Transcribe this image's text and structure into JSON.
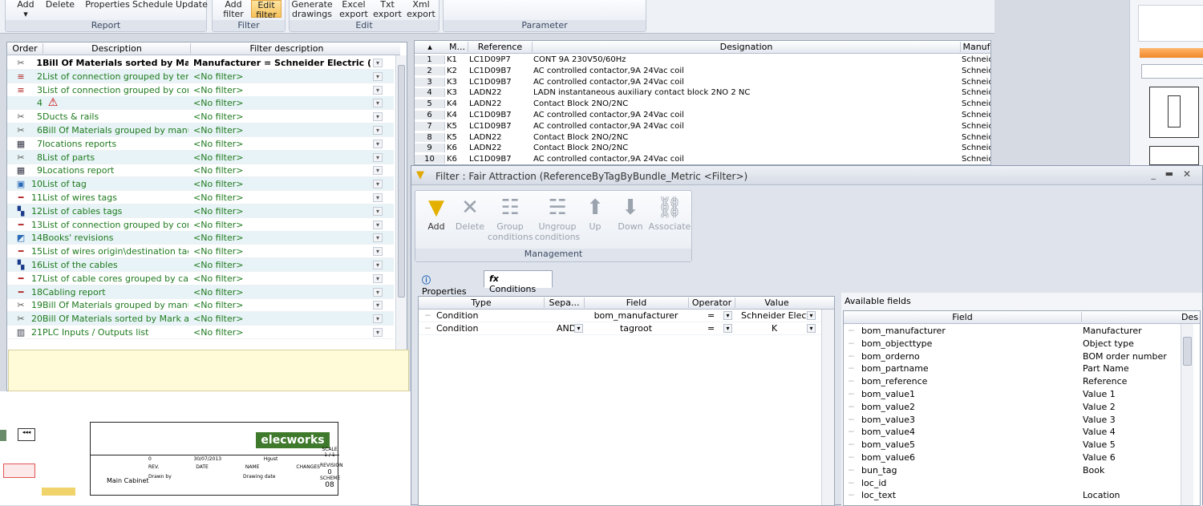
{
  "ribbon": {
    "report_buttons": [
      "Add",
      "Delete",
      "Properties",
      "Schedule",
      "Update"
    ],
    "report_group": "Report",
    "filter_buttons": [
      {
        "l1": "Add",
        "l2": "filter"
      },
      {
        "l1": "Edit",
        "l2": "filter"
      }
    ],
    "filter_group": "Filter",
    "edit_buttons": [
      {
        "l1": "Generate",
        "l2": "drawings"
      },
      {
        "l1": "Excel",
        "l2": "export"
      },
      {
        "l1": "Txt",
        "l2": "export"
      },
      {
        "l1": "Xml",
        "l2": "export"
      }
    ],
    "edit_group": "Edit",
    "parameter_group": "Parameter"
  },
  "reports": {
    "headers": {
      "order": "Order",
      "description": "Description",
      "filter": "Filter description"
    },
    "rows": [
      {
        "icon": "tools-icon",
        "order": "1",
        "description": "Bill Of Materials sorted by Mar...",
        "filter": "Manufacturer = Schneider Electric (Filt..."
      },
      {
        "icon": "list-icon",
        "order": "2",
        "description": "List of connection grouped by term...",
        "filter": "<No filter>"
      },
      {
        "icon": "list-icon",
        "order": "3",
        "description": "List of connection grouped by com...",
        "filter": "<No filter>"
      },
      {
        "icon": "warning-icon",
        "order": "4",
        "description": "",
        "filter": "<No filter>"
      },
      {
        "icon": "tools-icon",
        "order": "5",
        "description": "Ducts & rails",
        "filter": "<No filter>"
      },
      {
        "icon": "tools-icon",
        "order": "6",
        "description": "Bill Of Materials grouped by manuf...",
        "filter": "<No filter>"
      },
      {
        "icon": "cabinet-icon",
        "order": "7",
        "description": "locations reports",
        "filter": "<No filter>"
      },
      {
        "icon": "tools-icon",
        "order": "8",
        "description": "List of parts",
        "filter": "<No filter>"
      },
      {
        "icon": "cabinet-icon",
        "order": "9",
        "description": "Locations report",
        "filter": "<No filter>"
      },
      {
        "icon": "tag-icon",
        "order": "10",
        "description": "List of tag",
        "filter": "<No filter>"
      },
      {
        "icon": "wire-icon",
        "order": "11",
        "description": "List of wires tags",
        "filter": "<No filter>"
      },
      {
        "icon": "cable-icon",
        "order": "12",
        "description": "List of cables tags",
        "filter": "<No filter>"
      },
      {
        "icon": "wire-icon",
        "order": "13",
        "description": "List of connection grouped by com...",
        "filter": "<No filter>"
      },
      {
        "icon": "book-icon",
        "order": "14",
        "description": "Books' revisions",
        "filter": "<No filter>"
      },
      {
        "icon": "wire-icon",
        "order": "15",
        "description": "List of wires origin\\destination tags",
        "filter": "<No filter>"
      },
      {
        "icon": "cable-icon",
        "order": "16",
        "description": "List of the cables",
        "filter": "<No filter>"
      },
      {
        "icon": "wire-icon",
        "order": "17",
        "description": "List of cable cores grouped by cable",
        "filter": "<No filter>"
      },
      {
        "icon": "wire-icon",
        "order": "18",
        "description": "Cabling report",
        "filter": "<No filter>"
      },
      {
        "icon": "tools-icon",
        "order": "19",
        "description": "Bill Of Materials grouped by manuf...",
        "filter": "<No filter>"
      },
      {
        "icon": "tools-icon",
        "order": "20",
        "description": "Bill Of Materials sorted by Mark an...",
        "filter": "<No filter>"
      },
      {
        "icon": "plc-icon",
        "order": "21",
        "description": "PLC Inputs / Outputs list",
        "filter": "<No filter>"
      }
    ]
  },
  "components": {
    "headers": {
      "m": "M...",
      "reference": "Reference",
      "designation": "Designation",
      "manuf": "Manuf"
    },
    "rows": [
      {
        "n": "1",
        "m": "K1",
        "ref": "LC1D09P7",
        "des": "CONT 9A 230V50/60Hz",
        "man": "Schneic"
      },
      {
        "n": "2",
        "m": "K2",
        "ref": "LC1D09B7",
        "des": "AC controlled contactor,9A 24Vac coil",
        "man": "Schneic"
      },
      {
        "n": "3",
        "m": "K3",
        "ref": "LC1D09B7",
        "des": "AC controlled contactor,9A 24Vac coil",
        "man": "Schneic"
      },
      {
        "n": "4",
        "m": "K3",
        "ref": "LADN22",
        "des": "LADN instantaneous auxiliary contact block 2NO 2 NC",
        "man": "Schneic"
      },
      {
        "n": "5",
        "m": "K4",
        "ref": "LADN22",
        "des": "Contact Block 2NO/2NC",
        "man": "Schneic"
      },
      {
        "n": "6",
        "m": "K4",
        "ref": "LC1D09B7",
        "des": "AC controlled contactor,9A 24Vac coil",
        "man": "Schneic"
      },
      {
        "n": "7",
        "m": "K5",
        "ref": "LC1D09B7",
        "des": "AC controlled contactor,9A 24Vac coil",
        "man": "Schneic"
      },
      {
        "n": "8",
        "m": "K5",
        "ref": "LADN22",
        "des": "Contact Block 2NO/2NC",
        "man": "Schneic"
      },
      {
        "n": "9",
        "m": "K6",
        "ref": "LADN22",
        "des": "Contact Block 2NO/2NC",
        "man": "Schneic"
      },
      {
        "n": "10",
        "m": "K6",
        "ref": "LC1D09B7",
        "des": "AC controlled contactor,9A 24Vac coil",
        "man": "Schneic"
      }
    ]
  },
  "dialog": {
    "title": "Filter : Fair Attraction (ReferenceByTagByBundle_Metric <Filter>)",
    "management": {
      "buttons": [
        {
          "l1": "Add",
          "l2": ""
        },
        {
          "l1": "Delete",
          "l2": ""
        },
        {
          "l1": "Group",
          "l2": "conditions"
        },
        {
          "l1": "Ungroup",
          "l2": "conditions"
        },
        {
          "l1": "Up",
          "l2": ""
        },
        {
          "l1": "Down",
          "l2": ""
        },
        {
          "l1": "Associate",
          "l2": ""
        }
      ],
      "label": "Management"
    },
    "tabs": [
      "Properties",
      "Conditions"
    ],
    "conditions": {
      "headers": [
        "Type",
        "Sepa...",
        "Field",
        "Operator",
        "Value"
      ],
      "rows": [
        {
          "type": "Condition",
          "sep": "",
          "field": "bom_manufacturer",
          "op": "=",
          "value": "Schneider Electri"
        },
        {
          "type": "Condition",
          "sep": "AND",
          "field": "tagroot",
          "op": "=",
          "value": "K"
        }
      ]
    },
    "available": {
      "caption": "Available fields",
      "headers": [
        "Field",
        "Des"
      ],
      "rows": [
        {
          "f": "bom_manufacturer",
          "d": "Manufacturer"
        },
        {
          "f": "bom_objecttype",
          "d": "Object type"
        },
        {
          "f": "bom_orderno",
          "d": "BOM order number"
        },
        {
          "f": "bom_partname",
          "d": "Part Name"
        },
        {
          "f": "bom_reference",
          "d": "Reference"
        },
        {
          "f": "bom_value1",
          "d": "Value 1"
        },
        {
          "f": "bom_value2",
          "d": "Value 2"
        },
        {
          "f": "bom_value3",
          "d": "Value 3"
        },
        {
          "f": "bom_value4",
          "d": "Value 4"
        },
        {
          "f": "bom_value5",
          "d": "Value 5"
        },
        {
          "f": "bom_value6",
          "d": "Value 6"
        },
        {
          "f": "bun_tag",
          "d": "Book"
        },
        {
          "f": "loc_id",
          "d": ""
        },
        {
          "f": "loc_text",
          "d": "Location"
        }
      ]
    }
  },
  "drawing": {
    "cabinet_label": "Main Cabinet",
    "logo": "elecworks",
    "sheet": "08",
    "scale": "1 / 1",
    "revision": "0",
    "rev_number": "0",
    "rev_date": "30/07/2013",
    "rev_name": "Hgust",
    "lbl_rev": "REV.",
    "lbl_date": "DATE",
    "lbl_name": "NAME",
    "lbl_changes": "CHANGES",
    "lbl_scale": "SCALE",
    "lbl_revision": "REVISION",
    "lbl_sheet": "SCHEME",
    "lbl_drawn": "Drawn by",
    "lbl_drawing_date": "Drawing date"
  }
}
